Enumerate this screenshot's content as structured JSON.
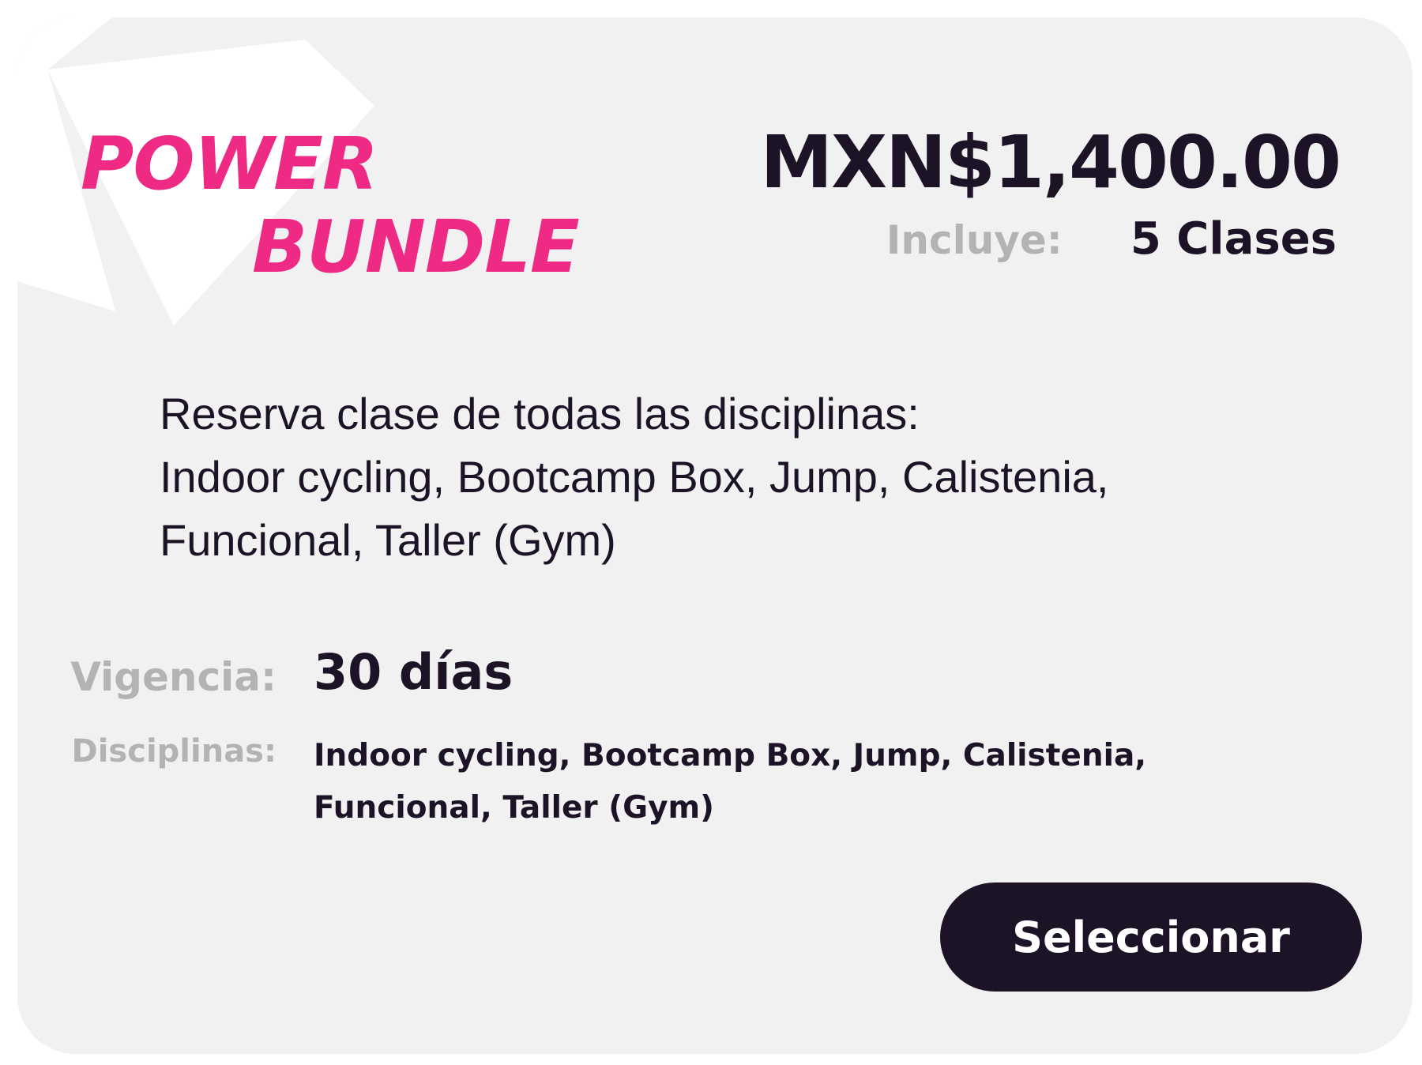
{
  "plan": {
    "title_line1": "POWER",
    "title_line2": "BUNDLE",
    "price": "MXN$1,400.00",
    "includes_label": "Incluye:",
    "includes_value": "5 Clases",
    "description_lines": [
      "Reserva clase de todas las disciplinas:",
      "Indoor cycling, Bootcamp Box, Jump, Calistenia,",
      "Funcional, Taller (Gym)"
    ],
    "validity_label": "Vigencia:",
    "validity_value": "30 días",
    "disciplines_label": "Disciplinas:",
    "disciplines_lines": [
      "Indoor cycling, Bootcamp Box, Jump, Calistenia,",
      "Funcional, Taller (Gym)"
    ],
    "select_label": "Seleccionar"
  },
  "colors": {
    "accent": "#ee2a85",
    "dark": "#1d1327",
    "muted": "#b3b3b3",
    "card_bg": "#f1f1f1"
  }
}
